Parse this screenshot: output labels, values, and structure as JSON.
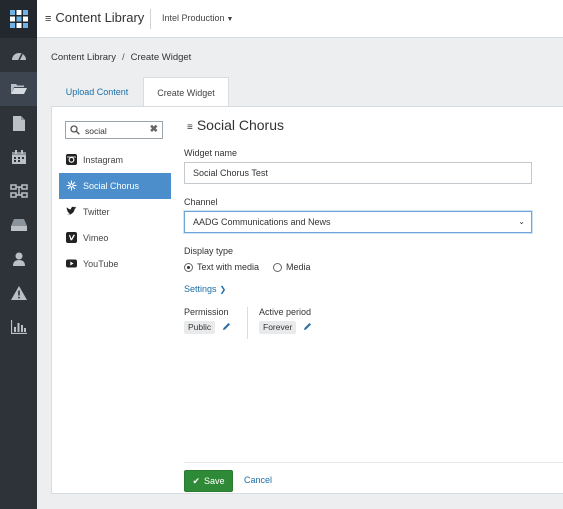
{
  "topbar": {
    "app_title": "Content Library",
    "environment": "Intel Production"
  },
  "breadcrumb": {
    "root": "Content Library",
    "current": "Create Widget"
  },
  "tabs": [
    {
      "label": "Upload Content",
      "active": false
    },
    {
      "label": "Create Widget",
      "active": true
    }
  ],
  "search": {
    "value": "social",
    "icon": "search-icon",
    "clear_icon": "clear-icon"
  },
  "widgets": [
    {
      "label": "Instagram",
      "icon": "instagram-icon",
      "active": false
    },
    {
      "label": "Social Chorus",
      "icon": "social-chorus-icon",
      "active": true
    },
    {
      "label": "Twitter",
      "icon": "twitter-icon",
      "active": false
    },
    {
      "label": "Vimeo",
      "icon": "vimeo-icon",
      "active": false
    },
    {
      "label": "YouTube",
      "icon": "youtube-icon",
      "active": false
    }
  ],
  "form": {
    "heading": "Social Chorus",
    "widget_name_label": "Widget name",
    "widget_name_value": "Social Chorus Test",
    "channel_label": "Channel",
    "channel_value": "AADG Communications and News",
    "display_type_label": "Display type",
    "display_options": [
      {
        "label": "Text with media",
        "selected": true
      },
      {
        "label": "Media",
        "selected": false
      }
    ],
    "settings_label": "Settings",
    "permission_label": "Permission",
    "permission_value": "Public",
    "active_period_label": "Active period",
    "active_period_value": "Forever"
  },
  "actions": {
    "save_label": "Save",
    "cancel_label": "Cancel"
  },
  "nav_rail": [
    "dashboard-icon",
    "folder-icon",
    "document-icon",
    "calendar-icon",
    "network-icon",
    "drive-icon",
    "user-icon",
    "warning-icon",
    "bar-chart-icon"
  ],
  "colors": {
    "rail": "#2d3339",
    "accent_blue": "#4c8ecb",
    "link_blue": "#1c6fa8",
    "save_green": "#2f8a37"
  }
}
